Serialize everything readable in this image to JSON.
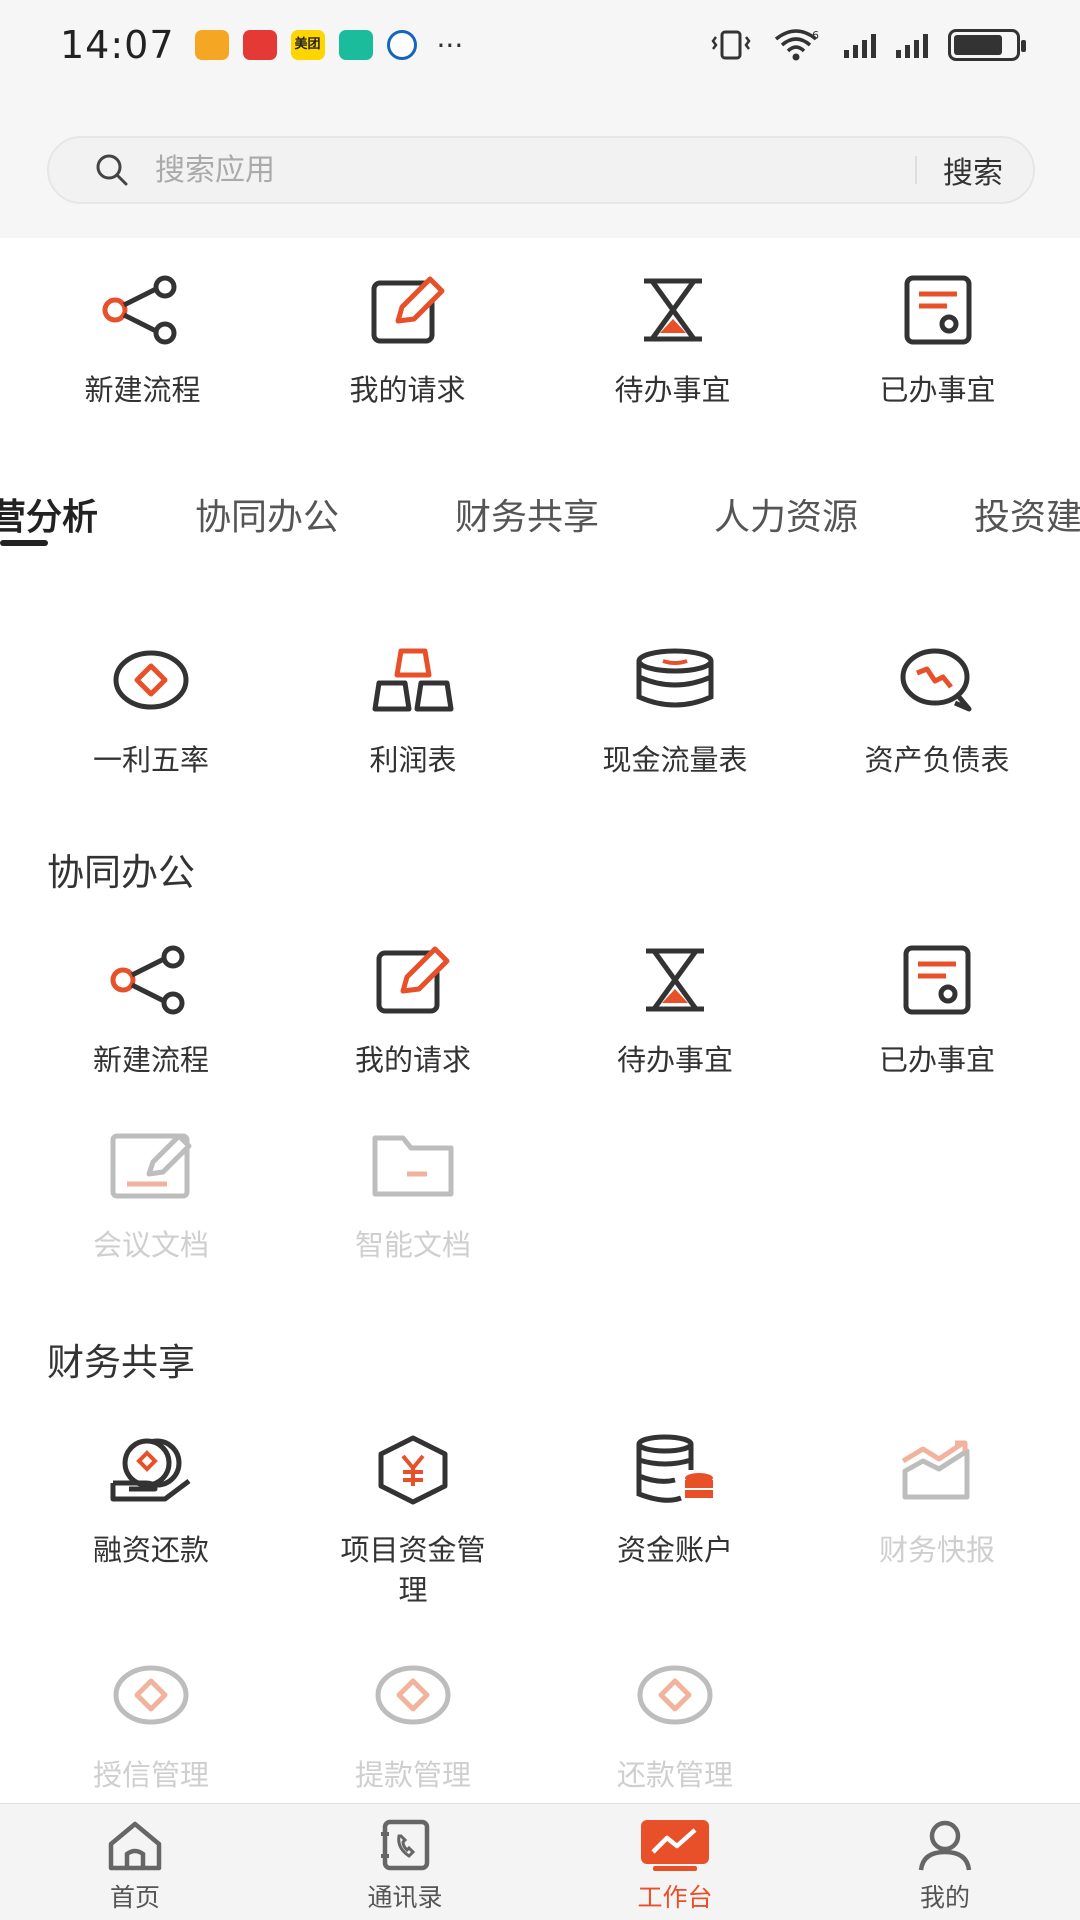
{
  "status_bar": {
    "time": "14:07",
    "more": "···",
    "network": "6",
    "notif_meituan": "美团"
  },
  "search": {
    "placeholder": "搜索应用",
    "button_label": "搜索"
  },
  "quick_actions": [
    {
      "label": "新建流程",
      "icon": "share-flow-icon"
    },
    {
      "label": "我的请求",
      "icon": "edit-request-icon"
    },
    {
      "label": "待办事宜",
      "icon": "hourglass-icon"
    },
    {
      "label": "已办事宜",
      "icon": "document-done-icon"
    }
  ],
  "tabs": [
    {
      "label": "营分析",
      "active": true
    },
    {
      "label": "协同办公"
    },
    {
      "label": "财务共享"
    },
    {
      "label": "人力资源"
    },
    {
      "label": "投资建"
    }
  ],
  "analysis_items": [
    {
      "label": "一利五率",
      "icon": "diamond-badge-icon"
    },
    {
      "label": "利润表",
      "icon": "gold-bars-icon"
    },
    {
      "label": "现金流量表",
      "icon": "coin-stack-icon"
    },
    {
      "label": "资产负债表",
      "icon": "chart-bubble-icon"
    }
  ],
  "section_collab": {
    "title": "协同办公",
    "items": [
      {
        "label": "新建流程",
        "icon": "share-flow-icon"
      },
      {
        "label": "我的请求",
        "icon": "edit-request-icon"
      },
      {
        "label": "待办事宜",
        "icon": "hourglass-icon"
      },
      {
        "label": "已办事宜",
        "icon": "document-done-icon"
      },
      {
        "label": "会议文档",
        "icon": "meeting-doc-icon",
        "disabled": true
      },
      {
        "label": "智能文档",
        "icon": "folder-icon",
        "disabled": true
      }
    ]
  },
  "section_finance": {
    "title": "财务共享",
    "items": [
      {
        "label": "融资还款",
        "icon": "coin-hand-icon"
      },
      {
        "label": "项目资金管理",
        "icon": "yuan-hexagon-icon"
      },
      {
        "label": "资金账户",
        "icon": "database-coins-icon"
      },
      {
        "label": "财务快报",
        "icon": "trend-chart-icon",
        "disabled": true
      },
      {
        "label": "授信管理",
        "icon": "diamond-badge-icon",
        "disabled": true
      },
      {
        "label": "提款管理",
        "icon": "diamond-badge-icon",
        "disabled": true
      },
      {
        "label": "还款管理",
        "icon": "diamond-badge-icon",
        "disabled": true
      }
    ]
  },
  "bottom_nav": [
    {
      "label": "首页",
      "icon": "home-icon"
    },
    {
      "label": "通讯录",
      "icon": "contacts-icon"
    },
    {
      "label": "工作台",
      "icon": "workbench-icon",
      "active": true
    },
    {
      "label": "我的",
      "icon": "profile-icon"
    }
  ],
  "colors": {
    "accent": "#e8502a",
    "dark": "#333333",
    "disabled": "#cfcfcf"
  }
}
